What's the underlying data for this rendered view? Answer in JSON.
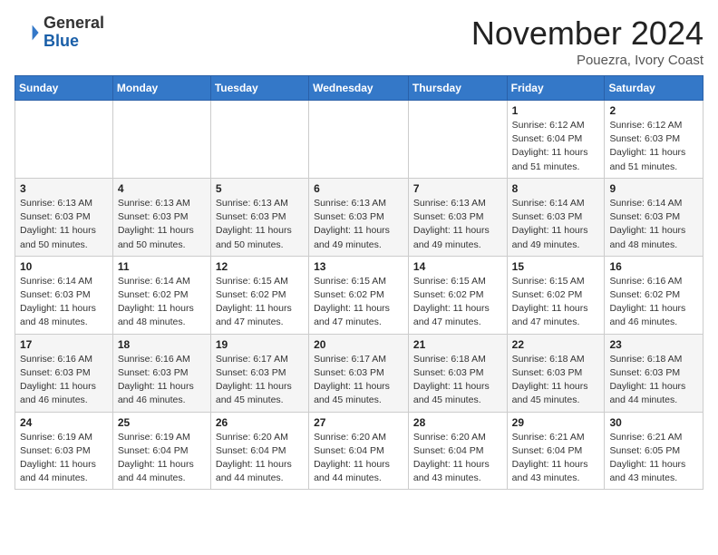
{
  "header": {
    "logo_line1": "General",
    "logo_line2": "Blue",
    "month": "November 2024",
    "location": "Pouezra, Ivory Coast"
  },
  "days_of_week": [
    "Sunday",
    "Monday",
    "Tuesday",
    "Wednesday",
    "Thursday",
    "Friday",
    "Saturday"
  ],
  "weeks": [
    [
      {
        "day": "",
        "info": ""
      },
      {
        "day": "",
        "info": ""
      },
      {
        "day": "",
        "info": ""
      },
      {
        "day": "",
        "info": ""
      },
      {
        "day": "",
        "info": ""
      },
      {
        "day": "1",
        "info": "Sunrise: 6:12 AM\nSunset: 6:04 PM\nDaylight: 11 hours and 51 minutes."
      },
      {
        "day": "2",
        "info": "Sunrise: 6:12 AM\nSunset: 6:03 PM\nDaylight: 11 hours and 51 minutes."
      }
    ],
    [
      {
        "day": "3",
        "info": "Sunrise: 6:13 AM\nSunset: 6:03 PM\nDaylight: 11 hours and 50 minutes."
      },
      {
        "day": "4",
        "info": "Sunrise: 6:13 AM\nSunset: 6:03 PM\nDaylight: 11 hours and 50 minutes."
      },
      {
        "day": "5",
        "info": "Sunrise: 6:13 AM\nSunset: 6:03 PM\nDaylight: 11 hours and 50 minutes."
      },
      {
        "day": "6",
        "info": "Sunrise: 6:13 AM\nSunset: 6:03 PM\nDaylight: 11 hours and 49 minutes."
      },
      {
        "day": "7",
        "info": "Sunrise: 6:13 AM\nSunset: 6:03 PM\nDaylight: 11 hours and 49 minutes."
      },
      {
        "day": "8",
        "info": "Sunrise: 6:14 AM\nSunset: 6:03 PM\nDaylight: 11 hours and 49 minutes."
      },
      {
        "day": "9",
        "info": "Sunrise: 6:14 AM\nSunset: 6:03 PM\nDaylight: 11 hours and 48 minutes."
      }
    ],
    [
      {
        "day": "10",
        "info": "Sunrise: 6:14 AM\nSunset: 6:03 PM\nDaylight: 11 hours and 48 minutes."
      },
      {
        "day": "11",
        "info": "Sunrise: 6:14 AM\nSunset: 6:02 PM\nDaylight: 11 hours and 48 minutes."
      },
      {
        "day": "12",
        "info": "Sunrise: 6:15 AM\nSunset: 6:02 PM\nDaylight: 11 hours and 47 minutes."
      },
      {
        "day": "13",
        "info": "Sunrise: 6:15 AM\nSunset: 6:02 PM\nDaylight: 11 hours and 47 minutes."
      },
      {
        "day": "14",
        "info": "Sunrise: 6:15 AM\nSunset: 6:02 PM\nDaylight: 11 hours and 47 minutes."
      },
      {
        "day": "15",
        "info": "Sunrise: 6:15 AM\nSunset: 6:02 PM\nDaylight: 11 hours and 47 minutes."
      },
      {
        "day": "16",
        "info": "Sunrise: 6:16 AM\nSunset: 6:02 PM\nDaylight: 11 hours and 46 minutes."
      }
    ],
    [
      {
        "day": "17",
        "info": "Sunrise: 6:16 AM\nSunset: 6:03 PM\nDaylight: 11 hours and 46 minutes."
      },
      {
        "day": "18",
        "info": "Sunrise: 6:16 AM\nSunset: 6:03 PM\nDaylight: 11 hours and 46 minutes."
      },
      {
        "day": "19",
        "info": "Sunrise: 6:17 AM\nSunset: 6:03 PM\nDaylight: 11 hours and 45 minutes."
      },
      {
        "day": "20",
        "info": "Sunrise: 6:17 AM\nSunset: 6:03 PM\nDaylight: 11 hours and 45 minutes."
      },
      {
        "day": "21",
        "info": "Sunrise: 6:18 AM\nSunset: 6:03 PM\nDaylight: 11 hours and 45 minutes."
      },
      {
        "day": "22",
        "info": "Sunrise: 6:18 AM\nSunset: 6:03 PM\nDaylight: 11 hours and 45 minutes."
      },
      {
        "day": "23",
        "info": "Sunrise: 6:18 AM\nSunset: 6:03 PM\nDaylight: 11 hours and 44 minutes."
      }
    ],
    [
      {
        "day": "24",
        "info": "Sunrise: 6:19 AM\nSunset: 6:03 PM\nDaylight: 11 hours and 44 minutes."
      },
      {
        "day": "25",
        "info": "Sunrise: 6:19 AM\nSunset: 6:04 PM\nDaylight: 11 hours and 44 minutes."
      },
      {
        "day": "26",
        "info": "Sunrise: 6:20 AM\nSunset: 6:04 PM\nDaylight: 11 hours and 44 minutes."
      },
      {
        "day": "27",
        "info": "Sunrise: 6:20 AM\nSunset: 6:04 PM\nDaylight: 11 hours and 44 minutes."
      },
      {
        "day": "28",
        "info": "Sunrise: 6:20 AM\nSunset: 6:04 PM\nDaylight: 11 hours and 43 minutes."
      },
      {
        "day": "29",
        "info": "Sunrise: 6:21 AM\nSunset: 6:04 PM\nDaylight: 11 hours and 43 minutes."
      },
      {
        "day": "30",
        "info": "Sunrise: 6:21 AM\nSunset: 6:05 PM\nDaylight: 11 hours and 43 minutes."
      }
    ]
  ]
}
